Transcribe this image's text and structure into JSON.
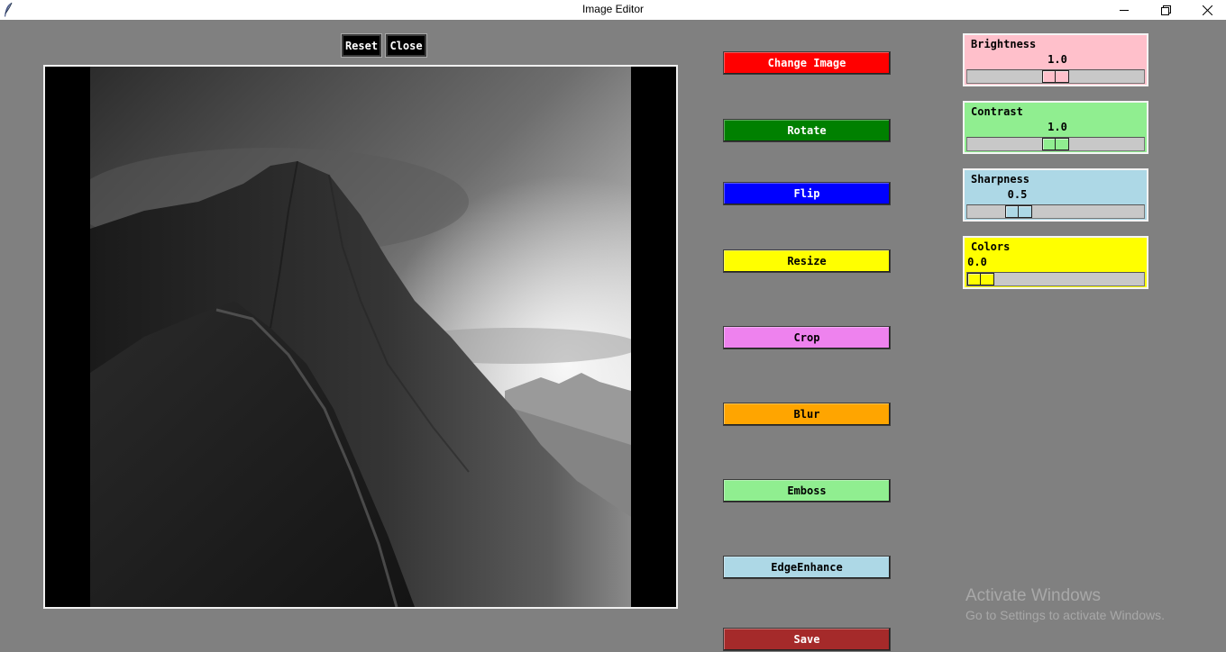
{
  "window": {
    "title": "Image Editor",
    "icons": [
      "feather-icon",
      "minimize-icon",
      "restore-icon",
      "close-icon"
    ]
  },
  "toolbar": {
    "reset_label": "Reset",
    "close_label": "Close"
  },
  "canvas": {
    "image": "black-and-white mountain ridge photo"
  },
  "actions": [
    {
      "label": "Change Image",
      "bg": "#ff0000",
      "fg": "#ffffff"
    },
    {
      "label": "Rotate",
      "bg": "#008000",
      "fg": "#ffffff"
    },
    {
      "label": "Flip",
      "bg": "#0000ff",
      "fg": "#ffffff"
    },
    {
      "label": "Resize",
      "bg": "#ffff00",
      "fg": "#000000"
    },
    {
      "label": "Crop",
      "bg": "#ee82ee",
      "fg": "#000000"
    },
    {
      "label": "Blur",
      "bg": "#ffa500",
      "fg": "#000000"
    },
    {
      "label": "Emboss",
      "bg": "#90ee90",
      "fg": "#000000"
    },
    {
      "label": "EdgeEnhance",
      "bg": "#add8e6",
      "fg": "#000000"
    },
    {
      "label": "Save",
      "bg": "#a52a2a",
      "fg": "#ffffff"
    }
  ],
  "scales": [
    {
      "label": "Brightness",
      "value": "1.0",
      "bg": "#ffc0cb",
      "level": 0.5
    },
    {
      "label": "Contrast",
      "value": "1.0",
      "bg": "#90ee90",
      "level": 0.5
    },
    {
      "label": "Sharpness",
      "value": "0.5",
      "bg": "#add8e6",
      "level": 0.25
    },
    {
      "label": "Colors",
      "value": "0.0",
      "bg": "#ffff00",
      "level": 0.0
    }
  ],
  "watermark": {
    "line1": "Activate Windows",
    "line2": "Go to Settings to activate Windows."
  }
}
